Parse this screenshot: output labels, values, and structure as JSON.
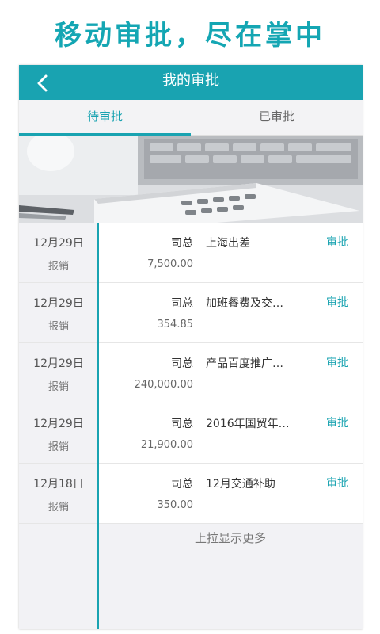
{
  "promo": {
    "title": "移动审批，尽在掌中"
  },
  "header": {
    "title": "我的审批",
    "back_icon": "chevron-left-icon"
  },
  "tabs": [
    {
      "label": "待审批",
      "active": true
    },
    {
      "label": "已审批",
      "active": false
    }
  ],
  "items": [
    {
      "date": "12月29日",
      "category": "报销",
      "name": "司总",
      "amount": "7,500.00",
      "subject": "上海出差",
      "action": "审批"
    },
    {
      "date": "12月29日",
      "category": "报销",
      "name": "司总",
      "amount": "354.85",
      "subject": "加班餐费及交…",
      "action": "审批"
    },
    {
      "date": "12月29日",
      "category": "报销",
      "name": "司总",
      "amount": "240,000.00",
      "subject": "产品百度推广…",
      "action": "审批"
    },
    {
      "date": "12月29日",
      "category": "报销",
      "name": "司总",
      "amount": "21,900.00",
      "subject": "2016年国贸年…",
      "action": "审批"
    },
    {
      "date": "12月18日",
      "category": "报销",
      "name": "司总",
      "amount": "350.00",
      "subject": "12月交通补助",
      "action": "审批"
    }
  ],
  "load_more": "上拉显示更多",
  "colors": {
    "accent": "#19a3b1"
  }
}
